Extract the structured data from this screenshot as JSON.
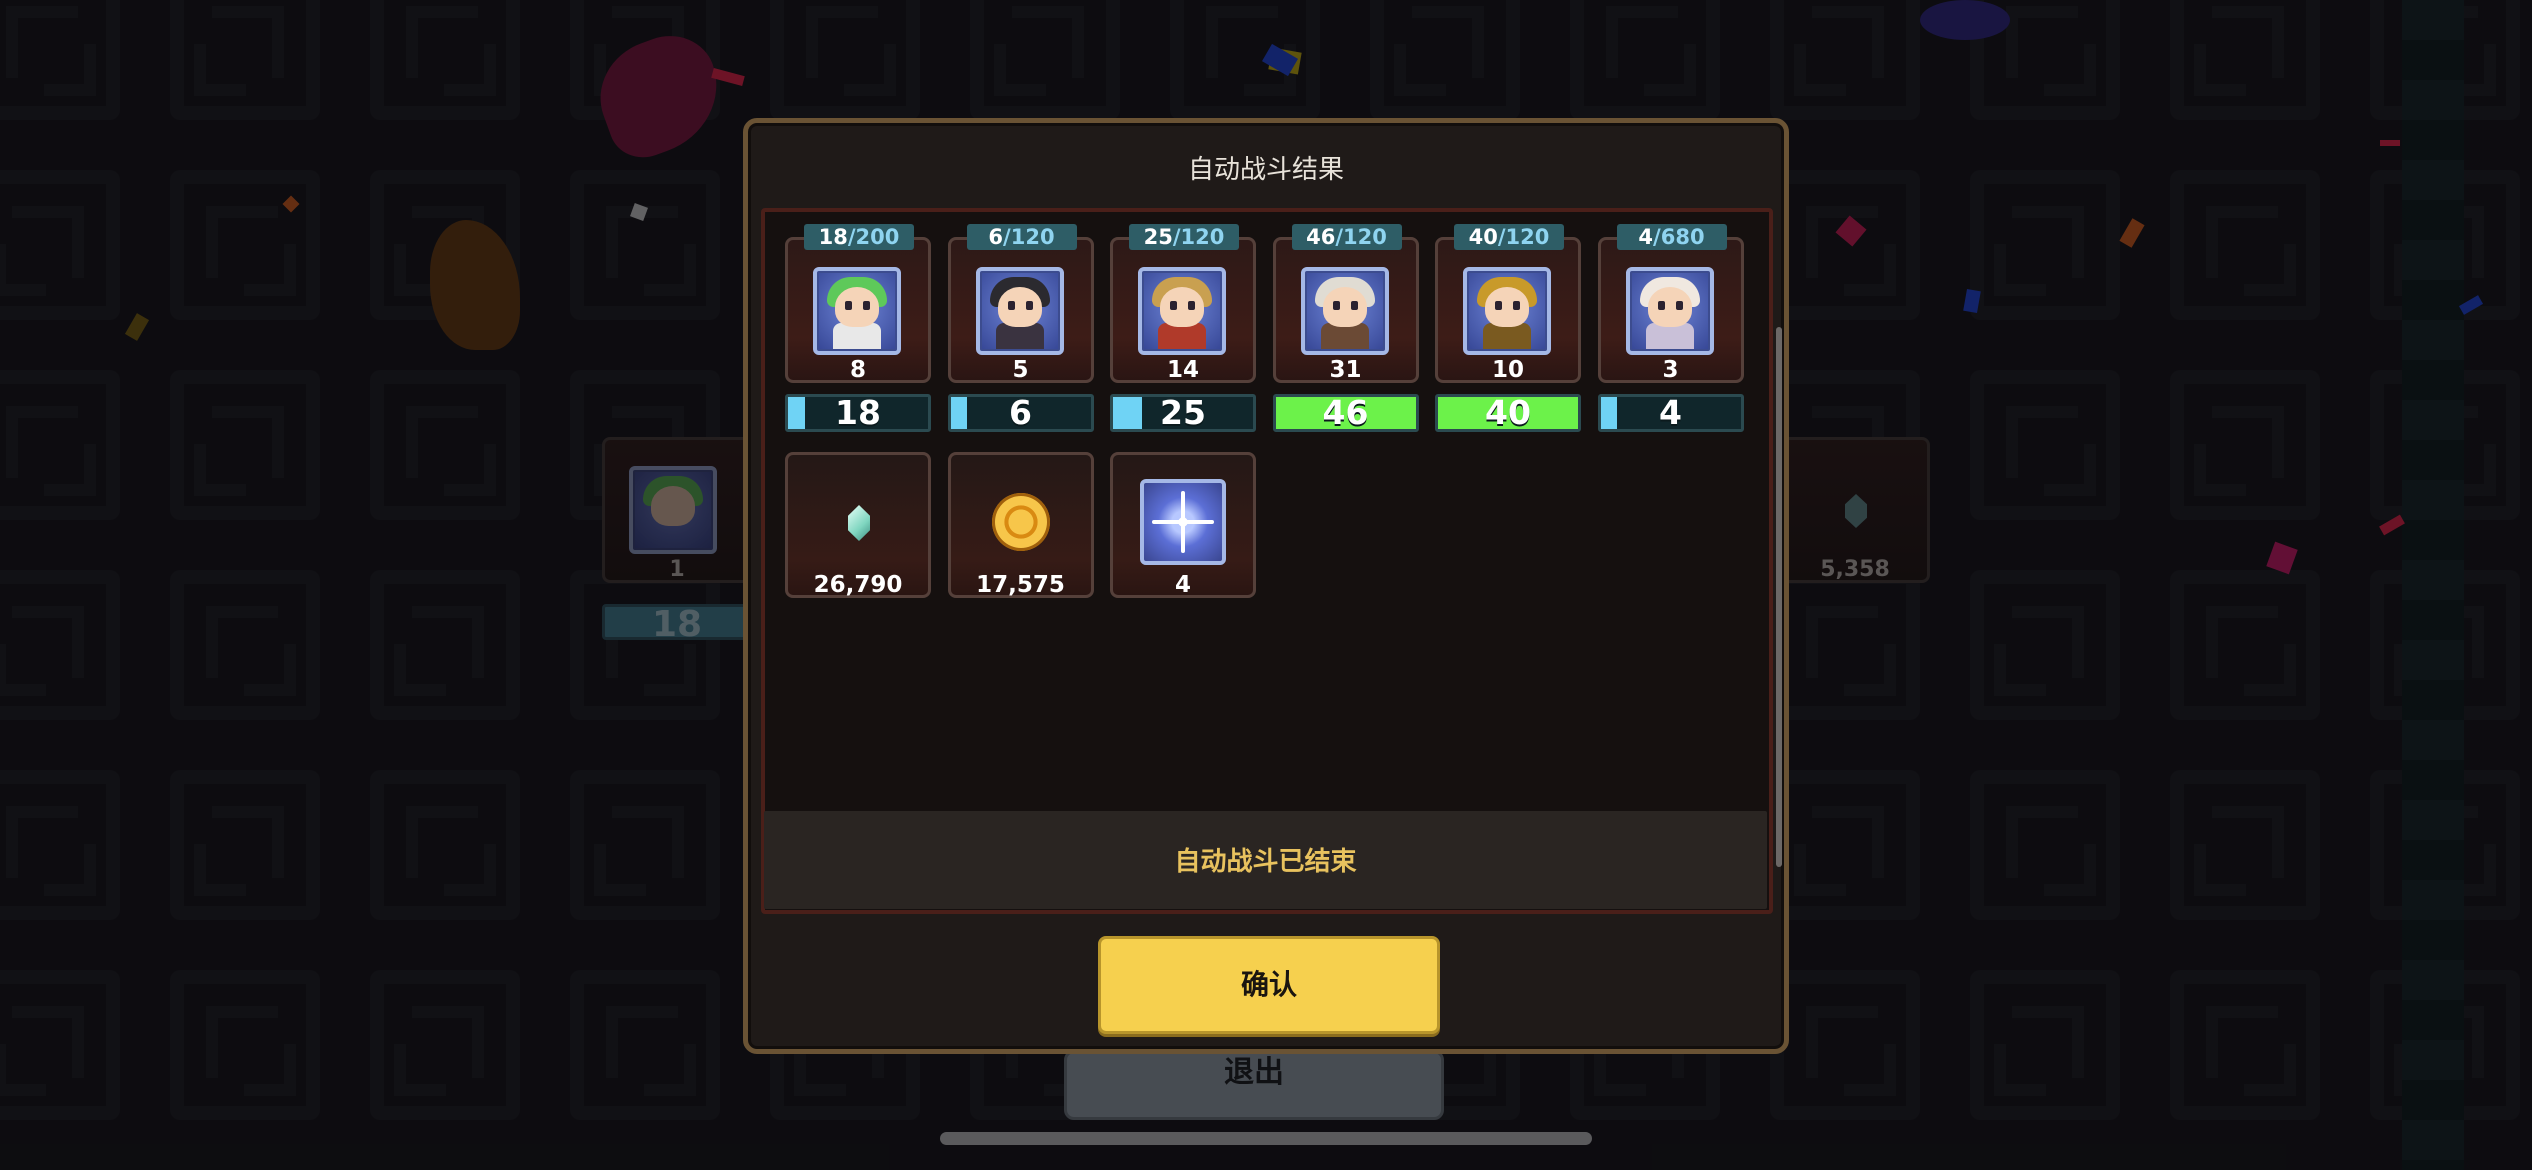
{
  "modal": {
    "title": "自动战斗结果",
    "status": "自动战斗已结束",
    "confirm_label": "确认"
  },
  "heroes": [
    {
      "collected": "18",
      "max": "200",
      "level": "8",
      "progress": "18",
      "fill": 0.09,
      "bar_color": "#6fd3f5",
      "hair": "#5ec95a",
      "outfit": "#e8e8e8"
    },
    {
      "collected": "6",
      "max": "120",
      "level": "5",
      "progress": "6",
      "fill": 0.05,
      "bar_color": "#6fd3f5",
      "hair": "#2b2a2f",
      "outfit": "#3a3340"
    },
    {
      "collected": "25",
      "max": "120",
      "level": "14",
      "progress": "25",
      "fill": 0.21,
      "bar_color": "#6fd3f5",
      "hair": "#c9a050",
      "outfit": "#b03a2a"
    },
    {
      "collected": "46",
      "max": "120",
      "level": "31",
      "progress": "46",
      "fill": 1.0,
      "bar_color": "#6cf24a",
      "hair": "#e0dcd3",
      "outfit": "#6b4a35"
    },
    {
      "collected": "40",
      "max": "120",
      "level": "10",
      "progress": "40",
      "fill": 1.0,
      "bar_color": "#6cf24a",
      "hair": "#c89a2a",
      "outfit": "#7a5a20"
    },
    {
      "collected": "4",
      "max": "680",
      "level": "3",
      "progress": "4",
      "fill": 0.01,
      "bar_color": "#6fd3f5",
      "hair": "#f0e8e0",
      "outfit": "#c9c0d8"
    }
  ],
  "rewards": [
    {
      "icon": "crystal-icon",
      "amount": "26,790"
    },
    {
      "icon": "gold-coin-icon",
      "amount": "17,575"
    },
    {
      "icon": "sparkle-box-icon",
      "amount": "4"
    }
  ],
  "background": {
    "left_card_level": "1",
    "left_card_progress": "18",
    "right_card_amount": "5,358",
    "exit_label": "退出"
  }
}
